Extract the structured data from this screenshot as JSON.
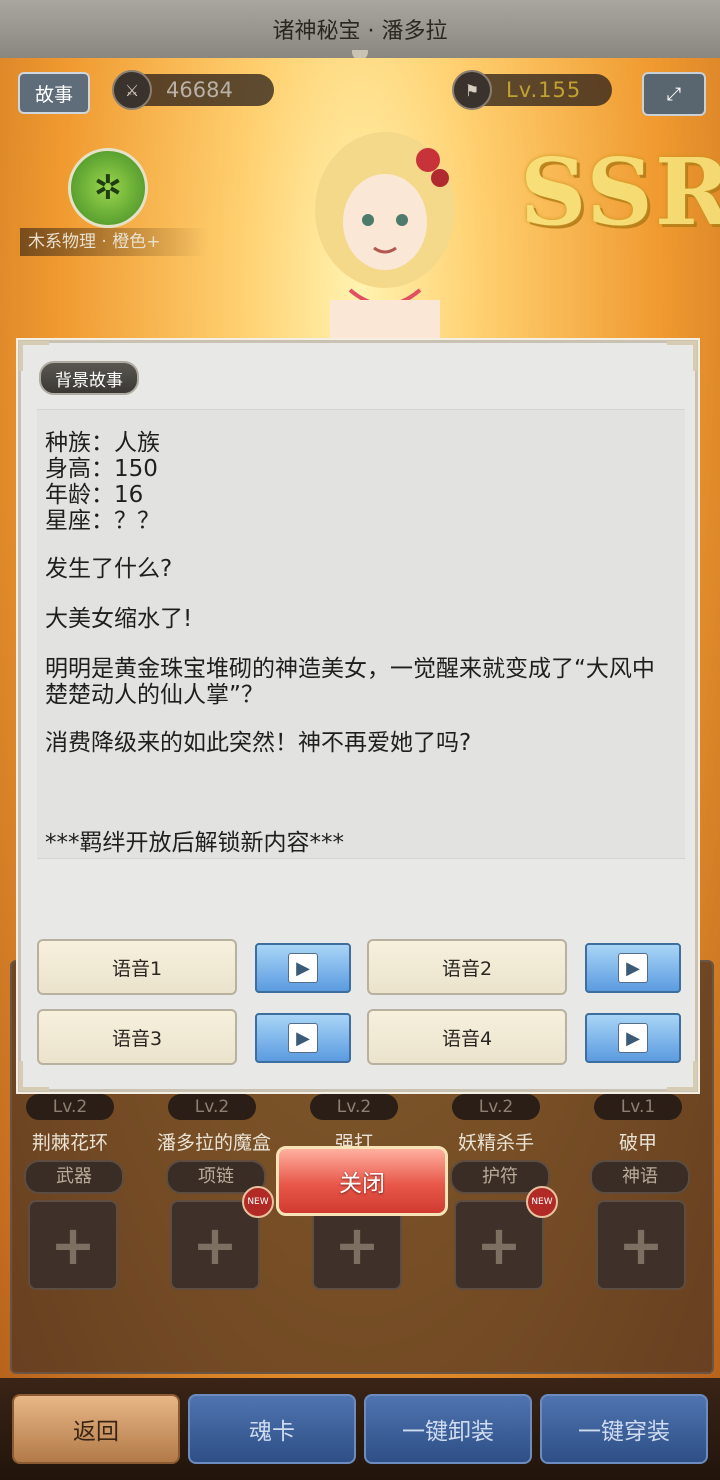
{
  "header": {
    "title": "诸神秘宝 · 潘多拉"
  },
  "top": {
    "story_button": "故事",
    "power_value": "46684",
    "level_value": "Lv.155",
    "expand_icon": "expand-arrows-icon",
    "element_label": "木系物理 · 橙色+",
    "rarity": "SSR"
  },
  "modal": {
    "tab_label": "背景故事",
    "lines": [
      "种族：人族",
      "身高：150",
      "年龄：16",
      "星座：？？",
      "发生了什么?",
      "大美女缩水了!",
      "明明是黄金珠宝堆砌的神造美女，一觉醒来就变成了“大风中楚楚动人的仙人掌”？",
      "消费降级来的如此突然！神不再爱她了吗?",
      "***羁绊开放后解锁新内容***"
    ],
    "voices": [
      "语音1",
      "语音2",
      "语音3",
      "语音4"
    ]
  },
  "equipment": {
    "slots": [
      {
        "lv": "Lv.2",
        "name": "荆棘花环",
        "type": "武器",
        "new": false
      },
      {
        "lv": "Lv.2",
        "name": "潘多拉的魔盒",
        "type": "项链",
        "new": true
      },
      {
        "lv": "Lv.2",
        "name": "强打",
        "type": "",
        "new": false
      },
      {
        "lv": "Lv.2",
        "name": "妖精杀手",
        "type": "护符",
        "new": true
      },
      {
        "lv": "Lv.1",
        "name": "破甲",
        "type": "神语",
        "new": false
      }
    ],
    "new_badge": "NEW"
  },
  "close_button": "关闭",
  "bottom": {
    "back": "返回",
    "soul_card": "魂卡",
    "unequip_all": "一键卸装",
    "equip_all": "一键穿装"
  },
  "colors": {
    "accent_orange": "#f09a30",
    "close_red": "#e8584a",
    "play_blue": "#5b9be0"
  }
}
